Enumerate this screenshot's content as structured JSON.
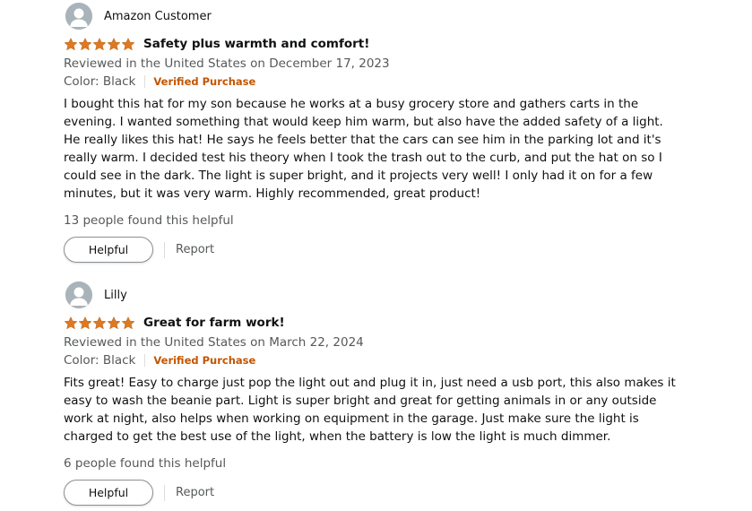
{
  "colors": {
    "star": "#de7921",
    "verified": "#c45500",
    "secondary_text": "#565959",
    "avatar": "#a9b3ba"
  },
  "reviews": [
    {
      "profile_name": "Amazon Customer",
      "rating": 5,
      "title": "Safety plus warmth and comfort!",
      "date": "Reviewed in the United States on December 17, 2023",
      "format": "Color: Black",
      "verified": "Verified Purchase",
      "body": "I bought this hat for my son because he works at a busy grocery store and gathers carts in the evening. I wanted something that would keep him warm, but also have the added safety of a light. He really likes this hat! He says he feels better that the cars can see him in the parking lot and it's really warm. I decided test his theory when I took the trash out to the curb, and put the hat on so I could see in the dark. The light is super bright, and it projects very well! I only had it on for a few minutes, but it was very warm. Highly recommended, great product!",
      "helpful_count": "13 people found this helpful",
      "helpful_label": "Helpful",
      "report_label": "Report"
    },
    {
      "profile_name": "Lilly",
      "rating": 5,
      "title": "Great for farm work!",
      "date": "Reviewed in the United States on March 22, 2024",
      "format": "Color: Black",
      "verified": "Verified Purchase",
      "body": "Fits great! Easy to charge just pop the light out and plug it in, just need a usb port, this also makes it easy to wash the beanie part. Light is super bright and great for getting animals in or any outside work at night, also helps when working on equipment in the garage. Just make sure the light is charged to get the best use of the light, when the battery is low the light is much dimmer.",
      "helpful_count": "6 people found this helpful",
      "helpful_label": "Helpful",
      "report_label": "Report"
    }
  ]
}
